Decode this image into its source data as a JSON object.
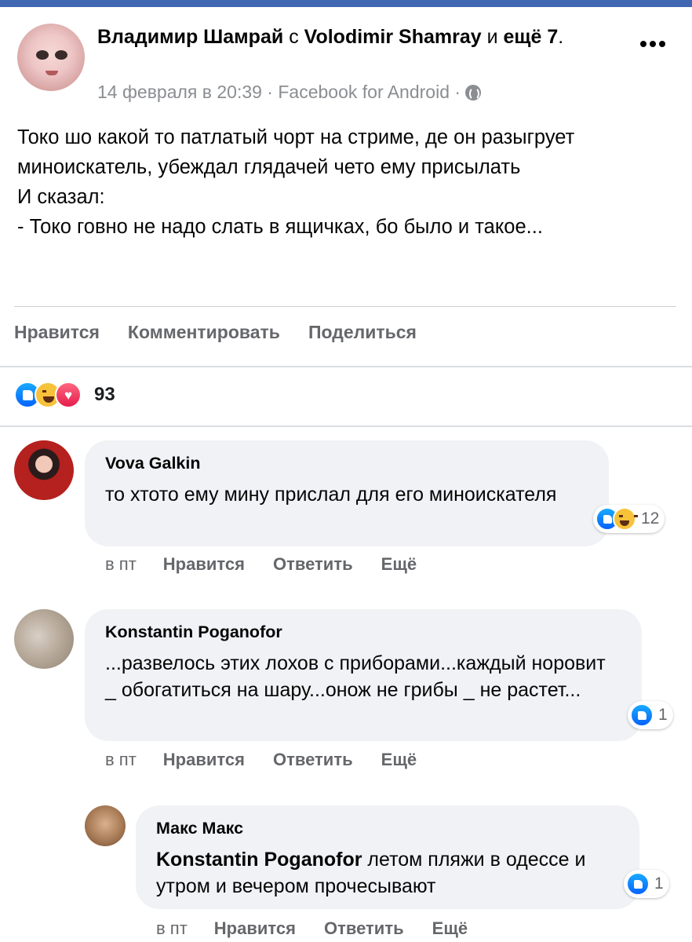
{
  "post": {
    "author": "Владимир Шамрай",
    "with_word": "с",
    "tagged": "Volodimir Shamray",
    "and_word": "и",
    "more_tagged": "ещё 7",
    "title_end": ".",
    "meta": "14 февраля в 20:39 · Facebook for Android ·",
    "privacy_icon": "globe-icon",
    "body": "Токо шо какой то патлатый чорт на стриме, де он разыгрует миноискатель, убеждал глядачей чето ему присылать\nИ сказал:\n- Токо говно не надо слать в ящичках, бо было и такое..."
  },
  "actions": {
    "like": "Нравится",
    "comment": "Комментировать",
    "share": "Поделиться"
  },
  "reactions": {
    "icons": [
      "like-icon",
      "haha-icon",
      "love-icon"
    ],
    "count": "93"
  },
  "comments": [
    {
      "author": "Vova Galkin",
      "text": "то хтото ему мину прислал для его миноискателя",
      "reaction_count": "12",
      "time": "в пт",
      "like": "Нравится",
      "reply": "Ответить",
      "more": "Ещё"
    },
    {
      "author": "Konstantin Poganofor",
      "text": "...развелось этих лохов с приборами...каждый норовит _ обогатиться на шару...онож не грибы _ не растет...",
      "reaction_count": "1",
      "time": "в пт",
      "like": "Нравится",
      "reply": "Ответить",
      "more": "Ещё"
    },
    {
      "author": "Макс Макс",
      "mention": "Konstantin Poganofor",
      "text": " летом пляжи в одессе и утром и вечером прочесывают",
      "reaction_count": "1",
      "time": "в пт",
      "like": "Нравится",
      "reply": "Ответить",
      "more": "Ещё"
    }
  ],
  "colors": {
    "brand": "#4267b2",
    "bubble": "#f0f2f5",
    "muted_text": "#65676b",
    "like_blue": "#1877f2",
    "love_red": "#f33e58",
    "haha_yellow": "#f7c23a"
  }
}
